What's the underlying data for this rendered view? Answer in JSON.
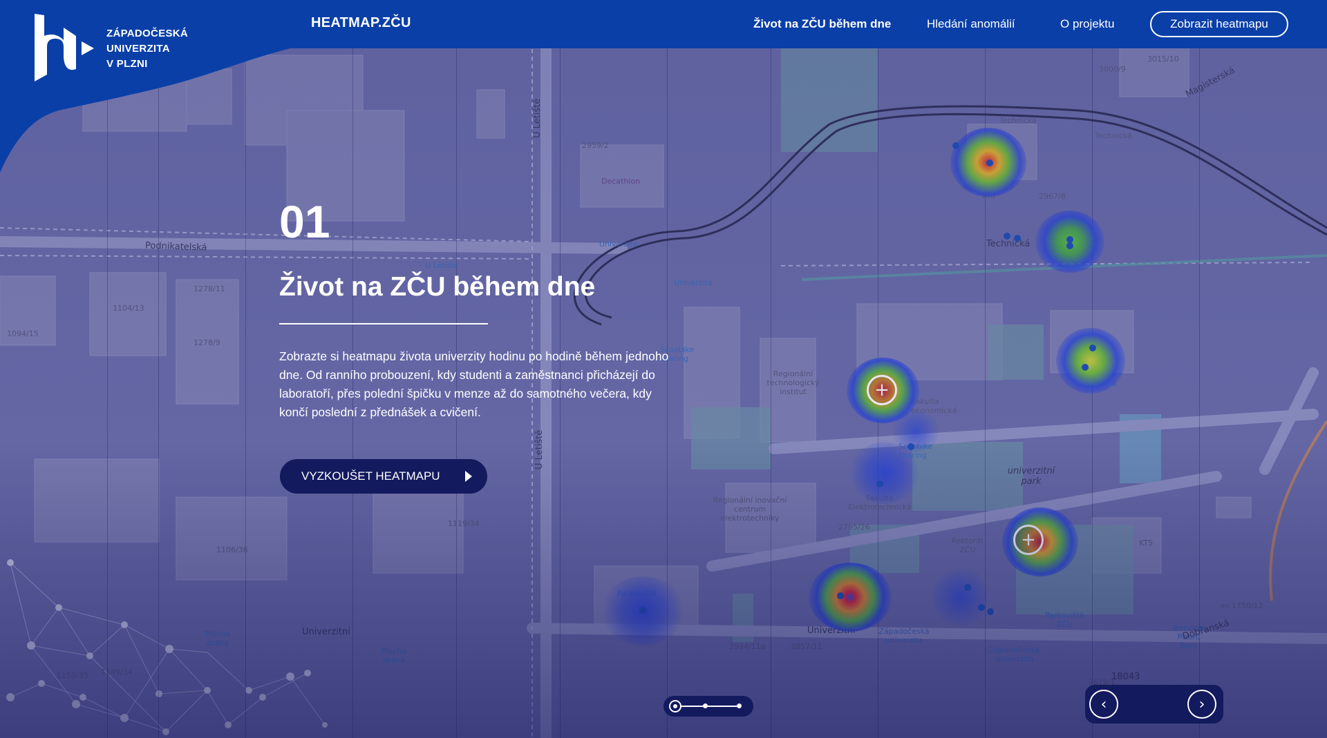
{
  "header": {
    "logo_lines": [
      "ZÁPADOČESKÁ",
      "UNIVERZITA",
      "V PLZNI"
    ],
    "brand": "HEATMAP.ZČU",
    "nav": [
      {
        "label": "Život na ZČU během dne",
        "active": true
      },
      {
        "label": "Hledání anomálií",
        "active": false
      },
      {
        "label": "O projektu",
        "active": false
      }
    ],
    "cta": "Zobrazit heatmapu"
  },
  "hero": {
    "number": "01",
    "title": "Život na ZČU během dne",
    "description": "Zobrazte si heatmapu života univerzity hodinu po hodině během jednoho dne. Od ranního probouzení, kdy studenti a zaměstnanci přicházejí do laboratoří, přes polední špičku v menze až do samotného večera, kdy končí poslední z přednášek a cvičení.",
    "button": "VYZKOUŠET HEATMAPU"
  },
  "map_labels": {
    "podnikatelska": "Podnikatelská",
    "u_letiste_1": "U Letiště",
    "u_letiste_2": "U Letiště",
    "u_letiste_stop": "U Letiště",
    "univerzitni_road": "Univerzitní",
    "univerzitni_stop": "Univerzitní",
    "dobranska": "Dobřanská",
    "magisterska": "Magisterská",
    "technicka_1": "Technická",
    "technicka_2": "Technická",
    "technicka_3": "Technická",
    "decathlon": "Decathlon",
    "univerzita_1": "Univerzita",
    "univerzita_2": "Univerzita",
    "scoobike_1": "Scoobike sharing",
    "scoobike_2": "Scoobike sharing",
    "scoobike_3": "Scoobike sharing",
    "rti": "Regionální technologický institut",
    "fakulta_ekonomicka": "Fakulta ekonomická",
    "fakulta_elektro": "Fakulta Elektrotechnická",
    "univerzitni_park": "univerzitní park",
    "ric": "Regionální inovační centrum elektrotechniky",
    "rektorat": "Rektorát ZČU",
    "kts": "KTS",
    "parkoviste": "Parkoviště ZČU",
    "zc_univerzita_1": "Západočeská univerzita",
    "zc_univerzita_2": "Západočeská univerzita",
    "aplikovanych_ved": "aplikovaných věd",
    "plocha_draha_1": "Plocha dráha",
    "plocha_draha_2": "Plocha dráha",
    "parkoviste_small": "Parkoviště",
    "benzina": "Benzina Plzeň, Bory",
    "n_2959": "2959/2",
    "n_3000": "3000/9",
    "n_3015": "3015/10",
    "n_1278_11": "1278/11",
    "n_1278_9": "1278/9",
    "n_1104": "1104/13",
    "n_1094": "1094/15",
    "n_1119": "1119/34",
    "n_1106": "1106/36",
    "n_1150": "1150/35",
    "n_1149": "1149/34",
    "n_2795": "2795/26",
    "n_2994": "2994/11a",
    "n_2857": "2857/11",
    "n_2967": "2967/8",
    "n_18043": "18043",
    "n_1750": "ev.1750/12",
    "n_2619": "2619/1"
  },
  "slider": {
    "position": 0,
    "steps": 3
  },
  "icons": {
    "prev": "chevron-left-icon",
    "next": "chevron-right-icon",
    "play": "play-icon",
    "plus": "plus-icon",
    "logo": "university-logo-icon"
  },
  "colors": {
    "header": "#0a3fa8",
    "button": "#131a5e",
    "overlay": "#5c5f9e"
  }
}
